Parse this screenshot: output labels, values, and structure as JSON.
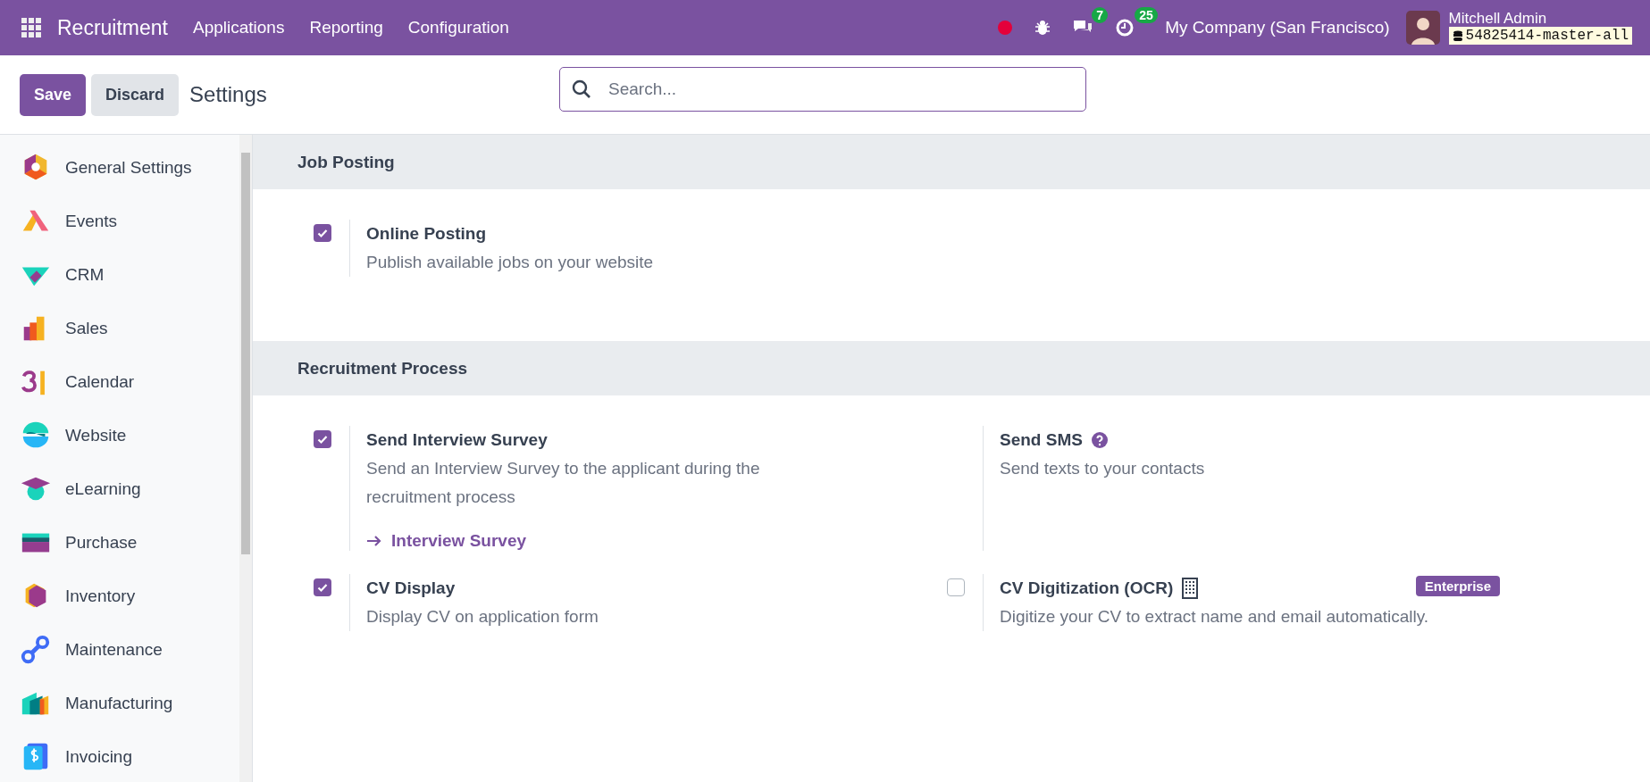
{
  "navbar": {
    "app_title": "Recruitment",
    "menu": [
      "Applications",
      "Reporting",
      "Configuration"
    ],
    "messages_count": "7",
    "activities_count": "25",
    "company": "My Company (San Francisco)",
    "user": "Mitchell Admin",
    "database": "54825414-master-all"
  },
  "control_panel": {
    "buttons": [
      {
        "label": "Save",
        "kind": "primary"
      },
      {
        "label": "Discard",
        "kind": "secondary"
      }
    ],
    "title": "Settings",
    "search": {
      "placeholder": "Search..."
    }
  },
  "sidebar": {
    "items": [
      {
        "label": "General Settings"
      },
      {
        "label": "Events"
      },
      {
        "label": "CRM"
      },
      {
        "label": "Sales"
      },
      {
        "label": "Calendar"
      },
      {
        "label": "Website"
      },
      {
        "label": "eLearning"
      },
      {
        "label": "Purchase"
      },
      {
        "label": "Inventory"
      },
      {
        "label": "Maintenance"
      },
      {
        "label": "Manufacturing"
      },
      {
        "label": "Invoicing"
      }
    ]
  },
  "sections": [
    {
      "title": "Job Posting",
      "settings": [
        {
          "kind": "toggle",
          "checked": true,
          "title": "Online Posting",
          "description": "Publish available jobs on your website"
        }
      ]
    },
    {
      "title": "Recruitment Process",
      "settings": [
        {
          "kind": "toggle",
          "checked": true,
          "title": "Send Interview Survey",
          "description": "Send an Interview Survey to the applicant during the recruitment process",
          "link": "Interview Survey"
        },
        {
          "kind": "info",
          "title": "Send SMS",
          "help": true,
          "description": "Send texts to your contacts"
        },
        {
          "kind": "toggle",
          "checked": true,
          "title": "CV Display",
          "description": "Display CV on application form"
        },
        {
          "kind": "toggle",
          "checked": false,
          "title": "CV Digitization (OCR)",
          "building_icon": true,
          "badge": "Enterprise",
          "description": "Digitize your CV to extract name and email automatically."
        }
      ]
    }
  ]
}
